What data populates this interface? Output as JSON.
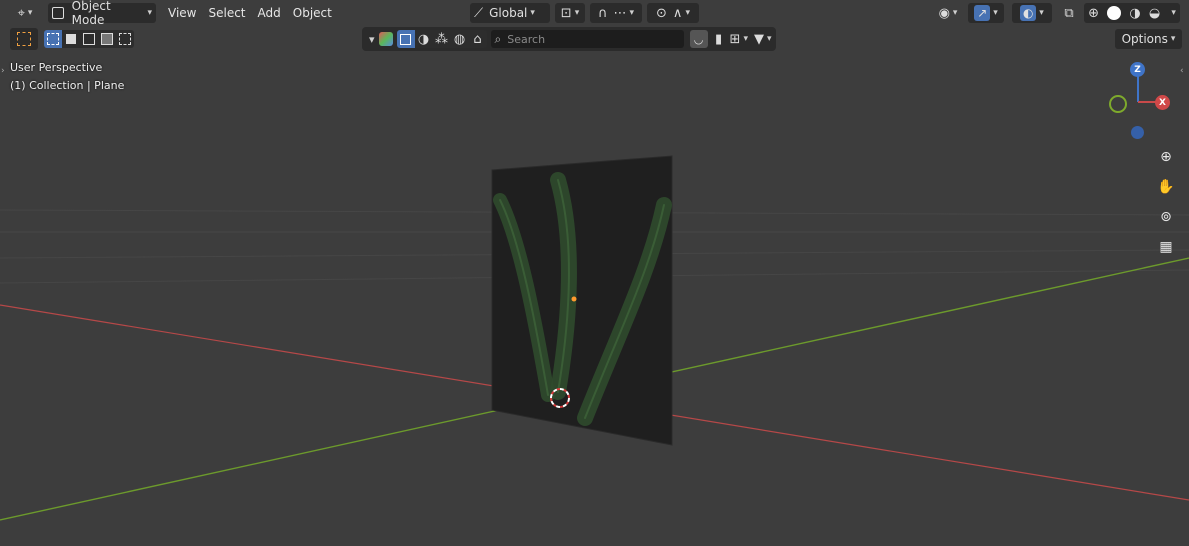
{
  "header": {
    "mode_label": "Object Mode",
    "menus": [
      "View",
      "Select",
      "Add",
      "Object"
    ],
    "transform_orientation": "Global",
    "options_label": "Options"
  },
  "outliner_bar": {
    "search_placeholder": "Search"
  },
  "viewport": {
    "perspective_label": "User Perspective",
    "collection_label": "(1) Collection | Plane"
  },
  "gizmo": {
    "z_label": "Z",
    "x_label": "X"
  },
  "nav_icons": [
    "zoom-icon",
    "hand-pan-icon",
    "camera-icon",
    "grid-ortho-icon"
  ],
  "colors": {
    "background": "#3d3d3d",
    "x_axis": "#c84a4a",
    "y_axis": "#6c9a2c",
    "z_axis": "#3f74c8",
    "active_blue": "#4772b3"
  }
}
